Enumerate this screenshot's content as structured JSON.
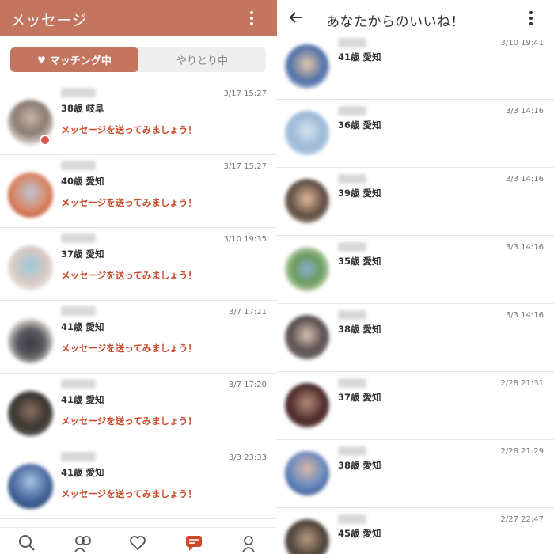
{
  "left": {
    "header_title": "メッセージ",
    "tabs": [
      {
        "label": "マッチング中",
        "icon": "heart-icon"
      },
      {
        "label": "やりとり中"
      }
    ],
    "messages": [
      {
        "meta": "38歳 岐阜",
        "time": "3/17 15:27",
        "prompt": "メッセージを送ってみましょう！"
      },
      {
        "meta": "40歳 愛知",
        "time": "3/17 15:27",
        "prompt": "メッセージを送ってみましょう！"
      },
      {
        "meta": "37歳 愛知",
        "time": "3/10 19:35",
        "prompt": "メッセージを送ってみましょう！"
      },
      {
        "meta": "41歳 愛知",
        "time": "3/7 17:21",
        "prompt": "メッセージを送ってみましょう！"
      },
      {
        "meta": "41歳 愛知",
        "time": "3/7 17:20",
        "prompt": "メッセージを送ってみましょう！"
      },
      {
        "meta": "41歳 愛知",
        "time": "3/3 23:33",
        "prompt": "メッセージを送ってみましょう！"
      }
    ],
    "nav": [
      "search-icon",
      "people-icon",
      "heart-icon",
      "message-icon",
      "profile-icon"
    ]
  },
  "right": {
    "header_title": "あなたからのいいね！",
    "likes": [
      {
        "meta": "41歳 愛知",
        "time": "3/10 19:41"
      },
      {
        "meta": "36歳 愛知",
        "time": "3/3 14:16"
      },
      {
        "meta": "39歳 愛知",
        "time": "3/3 14:16"
      },
      {
        "meta": "35歳 愛知",
        "time": "3/3 14:16"
      },
      {
        "meta": "38歳 愛知",
        "time": "3/3 14:16"
      },
      {
        "meta": "37歳 愛知",
        "time": "2/28 21:31"
      },
      {
        "meta": "38歳 愛知",
        "time": "2/28 21:29"
      },
      {
        "meta": "45歳 愛知",
        "time": "2/27 22:47"
      }
    ]
  },
  "colors": {
    "brand": "#c47560",
    "prompt": "#c94a2a",
    "nav_active": "#c94a2a"
  }
}
